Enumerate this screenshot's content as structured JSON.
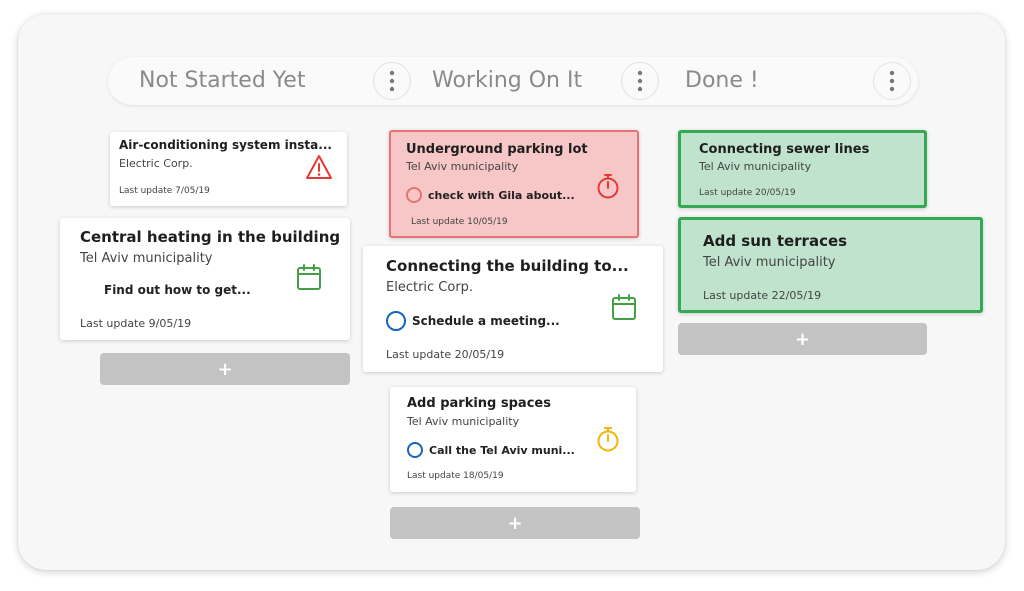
{
  "columns": [
    {
      "title": "Not Started Yet"
    },
    {
      "title": "Working On It"
    },
    {
      "title": "Done !"
    }
  ],
  "cards": {
    "c1": {
      "title": "Air-conditioning system insta...",
      "subtitle": "Electric Corp.",
      "updated": "Last update 7/05/19",
      "icon": "warning-icon"
    },
    "c2": {
      "title": "Central heating in the building",
      "subtitle": "Tel Aviv municipality",
      "task": "Find out how to get...",
      "updated": "Last update 9/05/19",
      "icon": "calendar-icon"
    },
    "w1": {
      "title": "Underground parking lot",
      "subtitle": "Tel Aviv municipality",
      "task": "check with Gila about...",
      "updated": "Last update 10/05/19",
      "icon": "stopwatch-icon"
    },
    "w2": {
      "title": "Connecting the building to...",
      "subtitle": "Electric Corp.",
      "task": "Schedule a meeting...",
      "updated": "Last update 20/05/19",
      "icon": "calendar-icon"
    },
    "w3": {
      "title": "Add parking spaces",
      "subtitle": "Tel Aviv municipality",
      "task": "Call the Tel Aviv muni...",
      "updated": "Last update 18/05/19",
      "icon": "stopwatch-icon"
    },
    "d1": {
      "title": "Connecting sewer lines",
      "subtitle": "Tel Aviv municipality",
      "updated": "Last update 20/05/19"
    },
    "d2": {
      "title": "Add sun terraces",
      "subtitle": "Tel Aviv municipality",
      "updated": "Last update 22/05/19"
    }
  },
  "add_label": "+",
  "colors": {
    "warning": "#e53935",
    "calendar": "#43a047",
    "stopwatch_red": "#e53935",
    "stopwatch_yellow": "#f4b400",
    "task_circle_blue": "#1565c0",
    "task_circle_red": "#e57373",
    "done_border": "#34a853",
    "stuck_border": "#e57373"
  }
}
